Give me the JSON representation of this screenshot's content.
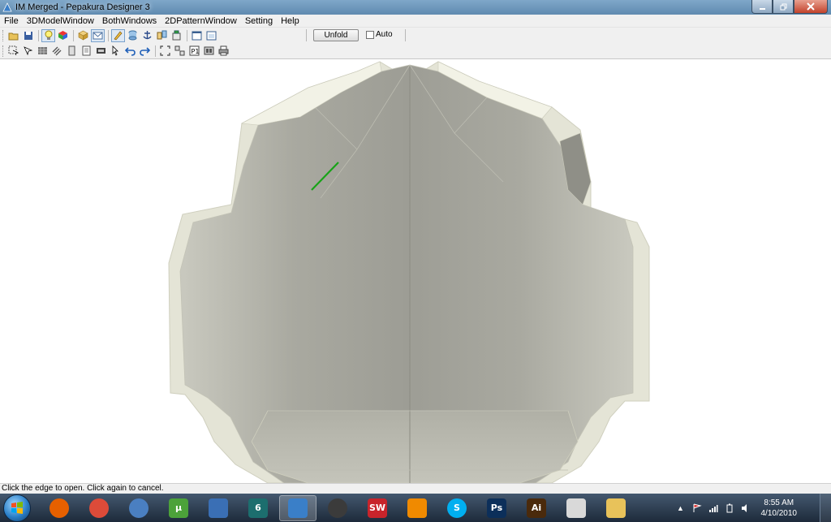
{
  "window": {
    "title": "IM Merged - Pepakura Designer 3"
  },
  "menu": {
    "items": [
      "File",
      "3DModelWindow",
      "BothWindows",
      "2DPatternWindow",
      "Setting",
      "Help"
    ]
  },
  "toolbar1": {
    "unfold_label": "Unfold",
    "auto_label": "Auto",
    "auto_checked": false
  },
  "status": {
    "text": "Click the edge to open. Click again to cancel."
  },
  "taskbar": {
    "apps": [
      {
        "name": "firefox-icon",
        "color": "#e66000",
        "glyph": ""
      },
      {
        "name": "chrome-icon",
        "color": "#dd4b39",
        "glyph": ""
      },
      {
        "name": "itunes-icon",
        "color": "#4a7fc1",
        "glyph": ""
      },
      {
        "name": "utorrent-icon",
        "color": "#4ca23a",
        "glyph": "µ"
      },
      {
        "name": "media-player-icon",
        "color": "#3a6fb5",
        "glyph": ""
      },
      {
        "name": "app-6-icon",
        "color": "#1c6e6e",
        "glyph": "6"
      },
      {
        "name": "pepakura-icon",
        "color": "#3a7fc8",
        "glyph": ""
      },
      {
        "name": "steam-icon",
        "color": "#3b3b3b",
        "glyph": ""
      },
      {
        "name": "solidworks-icon",
        "color": "#c8242b",
        "glyph": "SW"
      },
      {
        "name": "vlc-icon",
        "color": "#f08a00",
        "glyph": ""
      },
      {
        "name": "skype-icon",
        "color": "#00aff0",
        "glyph": "S"
      },
      {
        "name": "photoshop-icon",
        "color": "#0c2f5a",
        "glyph": "Ps"
      },
      {
        "name": "illustrator-icon",
        "color": "#4a2a0c",
        "glyph": "Ai"
      },
      {
        "name": "paint-icon",
        "color": "#d9d9d9",
        "glyph": ""
      },
      {
        "name": "explorer-icon",
        "color": "#e8c25a",
        "glyph": ""
      }
    ],
    "active_app": "pepakura-icon",
    "clock_time": "8:55 AM",
    "clock_date": "4/10/2010"
  },
  "colors": {
    "model_fill": "#a8a89e",
    "model_edge": "#d8d8c8",
    "selected_edge": "#17a317"
  }
}
